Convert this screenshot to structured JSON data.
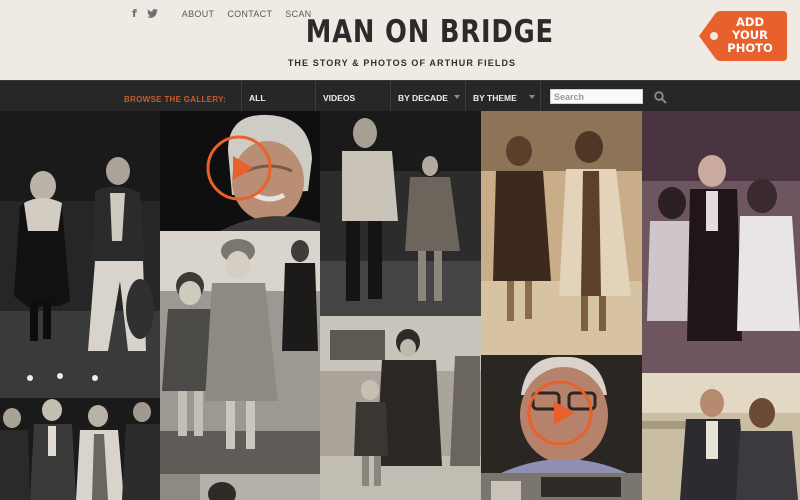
{
  "header": {
    "social": [
      {
        "name": "facebook",
        "glyph": "f"
      },
      {
        "name": "twitter",
        "glyph": "twitter-bird"
      }
    ],
    "links": [
      "ABOUT",
      "CONTACT",
      "SCAN"
    ],
    "logo_title": "MAN ON BRIDGE",
    "logo_subtitle": "THE STORY & PHOTOS OF ARTHUR FIELDS",
    "cta": "ADD\nYOUR\nPHOTO"
  },
  "gallery_nav": {
    "label": "BROWSE THE GALLERY:",
    "items": [
      "ALL",
      "VIDEOS",
      "BY DECADE",
      "BY THEME"
    ],
    "search_placeholder": "Search"
  },
  "colors": {
    "accent": "#e8612c",
    "nav_bg": "#272727",
    "page_bg": "#efebe4",
    "nav_label": "#c85c2c"
  },
  "tiles": [
    {
      "id": "couple-furcoat",
      "kind": "photo",
      "tone": "bw"
    },
    {
      "id": "elderly-man-video",
      "kind": "video",
      "tone": "color"
    },
    {
      "id": "couple-holding-hands",
      "kind": "photo",
      "tone": "bw"
    },
    {
      "id": "two-women-walking",
      "kind": "photo",
      "tone": "sepia"
    },
    {
      "id": "group-celebrating",
      "kind": "photo",
      "tone": "faded-color"
    },
    {
      "id": "two-girls-coats",
      "kind": "photo",
      "tone": "bw"
    },
    {
      "id": "woman-boy-street",
      "kind": "photo",
      "tone": "sepia-bw"
    },
    {
      "id": "men-night-street",
      "kind": "photo",
      "tone": "bw"
    },
    {
      "id": "man-glasses-video",
      "kind": "video",
      "tone": "color"
    },
    {
      "id": "couple-on-bridge",
      "kind": "photo",
      "tone": "color-faded"
    },
    {
      "id": "bottom-street",
      "kind": "photo",
      "tone": "bw"
    },
    {
      "id": "bottom-man",
      "kind": "photo",
      "tone": "bw"
    }
  ]
}
